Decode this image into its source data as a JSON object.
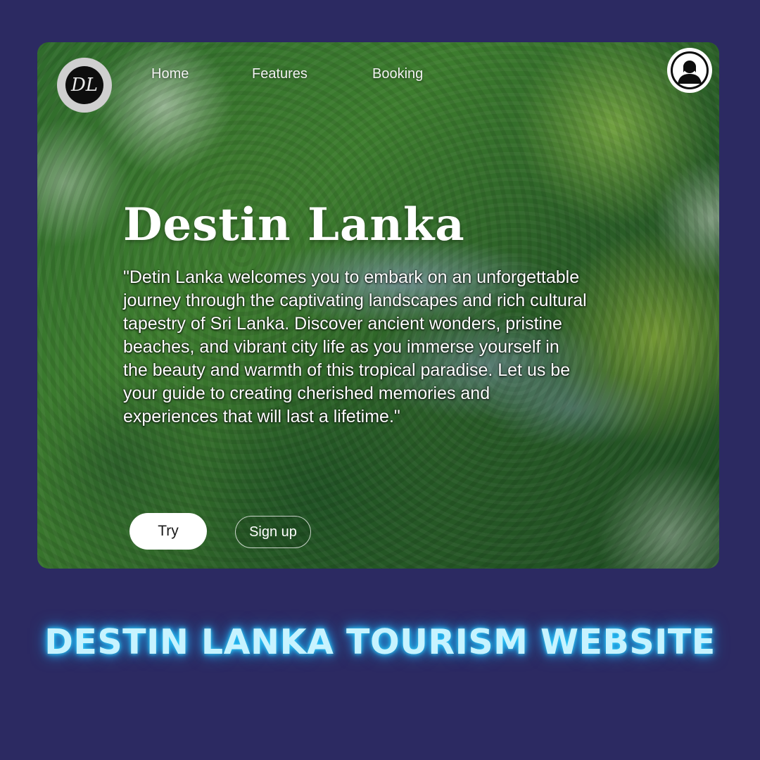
{
  "brand": {
    "logo_text": "DL"
  },
  "nav": {
    "items": [
      {
        "label": "Home"
      },
      {
        "label": "Features"
      },
      {
        "label": "Booking"
      }
    ]
  },
  "hero": {
    "title": "Destin Lanka",
    "description": "\"Detin Lanka welcomes you to embark on an unforgettable journey through the captivating landscapes and rich cultural tapestry of Sri Lanka. Discover ancient wonders, pristine beaches, and vibrant city life as you immerse yourself in the beauty and warmth of this tropical paradise. Let us be your guide to creating cherished memories and experiences that will last a lifetime.\"",
    "primary_button": "Try",
    "secondary_button": "Sign up"
  },
  "caption": "DESTIN LANKA TOURISM WEBSITE",
  "icons": {
    "avatar": "user-avatar-icon",
    "logo": "brand-logo-icon"
  },
  "colors": {
    "page_background": "#2c2a62",
    "caption_glow": "#2fd6ff",
    "caption_text": "#c7f3ff"
  }
}
